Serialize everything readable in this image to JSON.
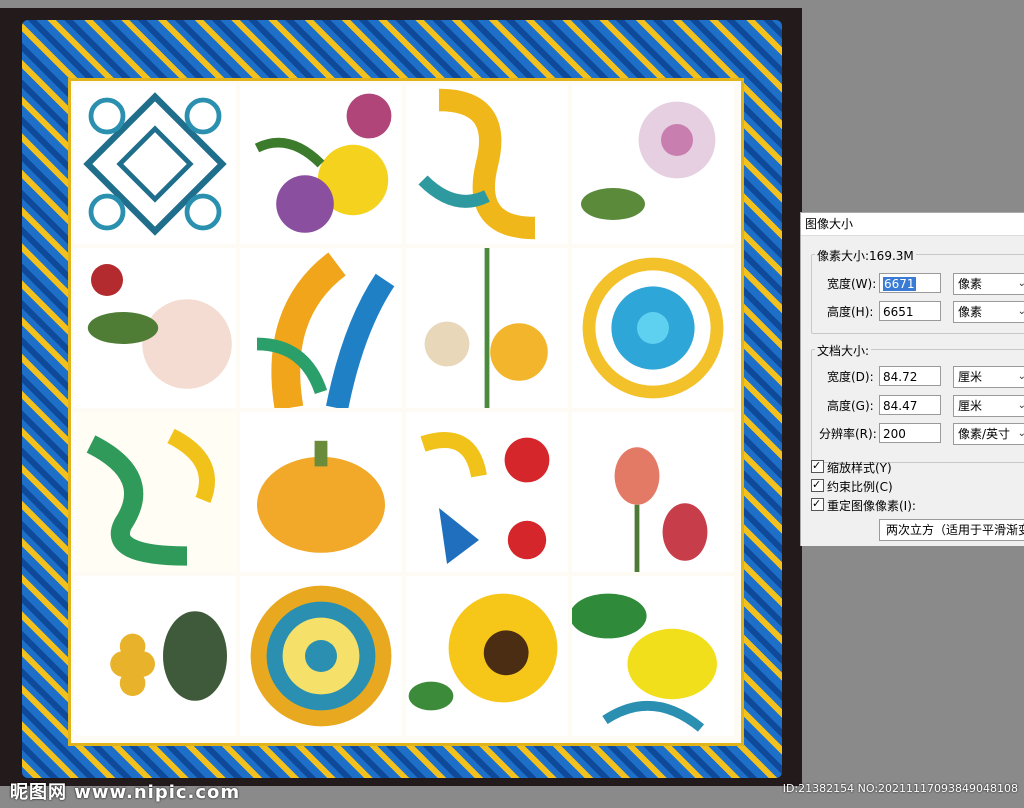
{
  "canvas": {
    "tiles": [
      {
        "name": "tile-lattice",
        "motif": "lattice"
      },
      {
        "name": "tile-flowers-purple",
        "motif": "flowers"
      },
      {
        "name": "tile-yellow-scroll",
        "motif": "scroll"
      },
      {
        "name": "tile-peony-pink",
        "motif": "peony"
      },
      {
        "name": "tile-white-rose",
        "motif": "rose"
      },
      {
        "name": "tile-blue-acanthus",
        "motif": "acanthus"
      },
      {
        "name": "tile-wildflowers",
        "motif": "wildflowers"
      },
      {
        "name": "tile-blue-medallion",
        "motif": "medallion"
      },
      {
        "name": "tile-green-ribbon",
        "motif": "ribbon"
      },
      {
        "name": "tile-pumpkin",
        "motif": "pumpkin"
      },
      {
        "name": "tile-red-blue-folk",
        "motif": "folk"
      },
      {
        "name": "tile-tulips",
        "motif": "tulips"
      },
      {
        "name": "tile-grapes",
        "motif": "grapes"
      },
      {
        "name": "tile-round-mandala",
        "motif": "mandala"
      },
      {
        "name": "tile-sunflower",
        "motif": "sunflower"
      },
      {
        "name": "tile-lemon",
        "motif": "lemon"
      }
    ]
  },
  "watermark": {
    "logo": "昵图网 www.nipic.com",
    "id_text": "ID:21382154 NO:20211117093849048108"
  },
  "dialog": {
    "title": "图像大小",
    "pixel_dimensions": {
      "label": "像素大小:169.3M",
      "width_label": "宽度(W):",
      "width_value": "6671",
      "width_unit": "像素",
      "height_label": "高度(H):",
      "height_value": "6651",
      "height_unit": "像素"
    },
    "document_size": {
      "label": "文档大小:",
      "width_label": "宽度(D):",
      "width_value": "84.72",
      "width_unit": "厘米",
      "height_label": "高度(G):",
      "height_value": "84.47",
      "height_unit": "厘米",
      "resolution_label": "分辨率(R):",
      "resolution_value": "200",
      "resolution_unit": "像素/英寸"
    },
    "checkboxes": {
      "scale_styles": "缩放样式(Y)",
      "constrain": "约束比例(C)",
      "resample": "重定图像像素(I):"
    },
    "resample_method": "两次立方（适用于平滑渐变）"
  },
  "colors": {
    "canvas_bg": "#231a1c",
    "ornament_blue": "#1e6fc8",
    "ornament_gold": "#f2c11e",
    "selection": "#3a7bd5"
  }
}
